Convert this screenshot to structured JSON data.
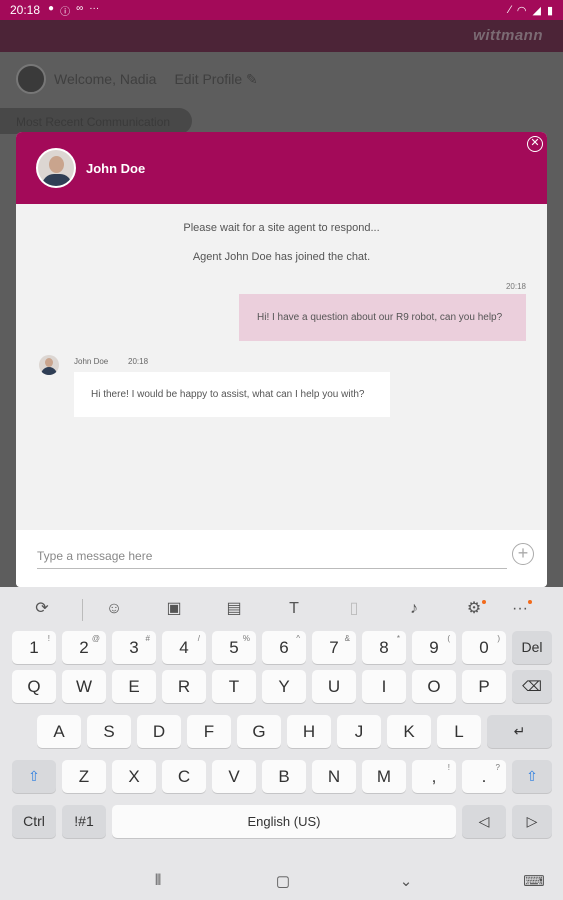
{
  "status_bar": {
    "time": "20:18"
  },
  "app": {
    "logo": "wittmann",
    "welcome": "Welcome, Nadia",
    "edit_profile": "Edit Profile",
    "recent_label": "Most Recent Communication"
  },
  "chat": {
    "agent_name": "John Doe",
    "system_messages": [
      "Please wait for a site agent to respond...",
      "Agent John Doe has joined the chat."
    ],
    "outgoing": {
      "time": "20:18",
      "text": "Hi! I have a question about our R9 robot, can you help?"
    },
    "incoming": {
      "name": "John Doe",
      "time": "20:18",
      "text": "Hi there! I would be happy to assist, what can I help you with?"
    },
    "input_placeholder": "Type a message here"
  },
  "keyboard": {
    "number_row": [
      {
        "k": "1",
        "s": "!"
      },
      {
        "k": "2",
        "s": "@"
      },
      {
        "k": "3",
        "s": "#"
      },
      {
        "k": "4",
        "s": "/"
      },
      {
        "k": "5",
        "s": "%"
      },
      {
        "k": "6",
        "s": "^"
      },
      {
        "k": "7",
        "s": "&"
      },
      {
        "k": "8",
        "s": "*"
      },
      {
        "k": "9",
        "s": "("
      },
      {
        "k": "0",
        "s": ")"
      }
    ],
    "del_label": "Del",
    "row1": [
      "Q",
      "W",
      "E",
      "R",
      "T",
      "Y",
      "U",
      "I",
      "O",
      "P"
    ],
    "row2": [
      "A",
      "S",
      "D",
      "F",
      "G",
      "H",
      "J",
      "K",
      "L"
    ],
    "row3": [
      "Z",
      "X",
      "C",
      "V",
      "B",
      "N",
      "M"
    ],
    "punct1": {
      "k": ",",
      "s": "!"
    },
    "punct2": {
      "k": ".",
      "s": "?"
    },
    "ctrl_label": "Ctrl",
    "sym_label": "!#1",
    "space_label": "English (US)"
  }
}
